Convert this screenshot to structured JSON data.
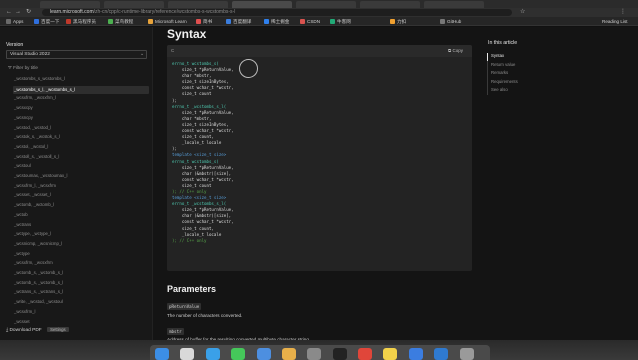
{
  "browser": {
    "url_host": "learn.microsoft.com",
    "url_path": "/zh-cn/cpp/c-runtime-library/reference/wcstombs-s-wcstombs-s-l",
    "bookmarks": [
      {
        "label": "Apps",
        "color": "#6a6a6a"
      },
      {
        "label": "百度一下",
        "color": "#2f6fde"
      },
      {
        "label": "黑马程序员",
        "color": "#c0392b"
      },
      {
        "label": "菜鸟教程",
        "color": "#4caf50"
      },
      {
        "label": "Microsoft Learn",
        "color": "#e8a33a"
      },
      {
        "label": "简书",
        "color": "#e05050"
      },
      {
        "label": "百度翻译",
        "color": "#3b7ddd"
      },
      {
        "label": "稀土掘金",
        "color": "#2f80ed"
      },
      {
        "label": "CSDN",
        "color": "#d9534f"
      },
      {
        "label": "牛客网",
        "color": "#22aa77"
      },
      {
        "label": "力扣",
        "color": "#f0a030"
      },
      {
        "label": "GitHub",
        "color": "#777777"
      }
    ],
    "reading_list": "Reading List"
  },
  "sidebar": {
    "version_label": "Version",
    "version_value": "Visual Studio 2022",
    "filter_placeholder": "Filter by title",
    "items": [
      "_wcstombs_s_wcstombs_l",
      "_wcstombs_s_l, _wcstombs_s_l",
      "_wcsxfrm, _wcsxfrm_l",
      "_wcsxcpy",
      "_wcsncpy",
      "_wcstod, _wcstod_l",
      "_wcstok_s, _wcstok_s_l",
      "_wcstol, _wcstol_l",
      "_wcstoll_s, _wcstoll_s_l",
      "_wcstoul",
      "_wcstoumax, _wcstoumax_l",
      "_wcsxfrm_l, _wcsxfrm",
      "_wcsset, _wcsset_l",
      "_wctomb, _wctomb_l",
      "_wctob",
      "_wctrans",
      "_wctype, _wctype_l",
      "_wcsnicmp, _wcsnicmp_l",
      "_wctype",
      "_wcsxfrm, _wcsxfrm",
      "_wctomb_s, _wctomb_s_l",
      "_wctomb_s, _wctomb_s_l",
      "_wctrans_s, _wctrans_s_l",
      "_write, _wcstod, _wcstoul",
      "_wcsxfrm_l",
      "_wcsset"
    ],
    "active_index": 1,
    "download_label": "Download PDF",
    "download_pill": "Settings"
  },
  "main": {
    "syntax_title": "Syntax",
    "code_lang": "C",
    "copy_label": "Copy",
    "code_lines": [
      {
        "kind": "t",
        "text": "errno_t wcstombs_s("
      },
      {
        "kind": "",
        "text": "    size_t *pReturnValue,"
      },
      {
        "kind": "",
        "text": "    char *mbstr,"
      },
      {
        "kind": "",
        "text": "    size_t sizeInBytes,"
      },
      {
        "kind": "",
        "text": "    const wchar_t *wcstr,"
      },
      {
        "kind": "",
        "text": "    size_t count"
      },
      {
        "kind": "",
        "text": ");"
      },
      {
        "kind": "t",
        "text": "errno_t _wcstombs_s_l("
      },
      {
        "kind": "",
        "text": "    size_t *pReturnValue,"
      },
      {
        "kind": "",
        "text": "    char *mbstr,"
      },
      {
        "kind": "",
        "text": "    size_t sizeInBytes,"
      },
      {
        "kind": "",
        "text": "    const wchar_t *wcstr,"
      },
      {
        "kind": "",
        "text": "    size_t count,"
      },
      {
        "kind": "",
        "text": "    _locale_t locale"
      },
      {
        "kind": "",
        "text": ");"
      },
      {
        "kind": "k",
        "text": "template <size_t size>"
      },
      {
        "kind": "t",
        "text": "errno_t wcstombs_s("
      },
      {
        "kind": "",
        "text": "    size_t *pReturnValue,"
      },
      {
        "kind": "",
        "text": "    char (&mbstr)[size],"
      },
      {
        "kind": "",
        "text": "    const wchar_t *wcstr,"
      },
      {
        "kind": "",
        "text": "    size_t count"
      },
      {
        "kind": "c",
        "text": "); // C++ only"
      },
      {
        "kind": "k",
        "text": "template <size_t size>"
      },
      {
        "kind": "t",
        "text": "errno_t _wcstombs_s_l("
      },
      {
        "kind": "",
        "text": "    size_t *pReturnValue,"
      },
      {
        "kind": "",
        "text": "    char (&mbstr)[size],"
      },
      {
        "kind": "",
        "text": "    const wchar_t *wcstr,"
      },
      {
        "kind": "",
        "text": "    size_t count,"
      },
      {
        "kind": "",
        "text": "    _locale_t locale"
      },
      {
        "kind": "c",
        "text": "); // C++ only"
      }
    ],
    "params_title": "Parameters",
    "params": [
      {
        "name": "pReturnValue",
        "desc": "The number of characters converted."
      },
      {
        "name": "mbstr",
        "desc": "Address of buffer for the resulting converted multibyte character string."
      }
    ]
  },
  "toc": {
    "title": "In this article",
    "items": [
      "Syntax",
      "Return value",
      "Remarks",
      "Requirements",
      "See also"
    ],
    "active_index": 0
  },
  "dock": {
    "apps": [
      {
        "name": "finder-icon",
        "color": "#3c8ee6"
      },
      {
        "name": "launchpad-icon",
        "color": "#d9d9d9"
      },
      {
        "name": "safari-icon",
        "color": "#3aa0e8"
      },
      {
        "name": "messages-icon",
        "color": "#45c75a"
      },
      {
        "name": "mail-icon",
        "color": "#4d8fe0"
      },
      {
        "name": "photos-icon",
        "color": "#e8b04a"
      },
      {
        "name": "settings-icon",
        "color": "#8a8a8a"
      },
      {
        "name": "terminal-icon",
        "color": "#222222"
      },
      {
        "name": "chrome-icon",
        "color": "#e0463a"
      },
      {
        "name": "notes-icon",
        "color": "#f2d24a"
      },
      {
        "name": "xcode-icon",
        "color": "#3b7de0"
      },
      {
        "name": "vscode-icon",
        "color": "#2f7ad0"
      },
      {
        "name": "trash-icon",
        "color": "#9a9a9a"
      }
    ]
  }
}
